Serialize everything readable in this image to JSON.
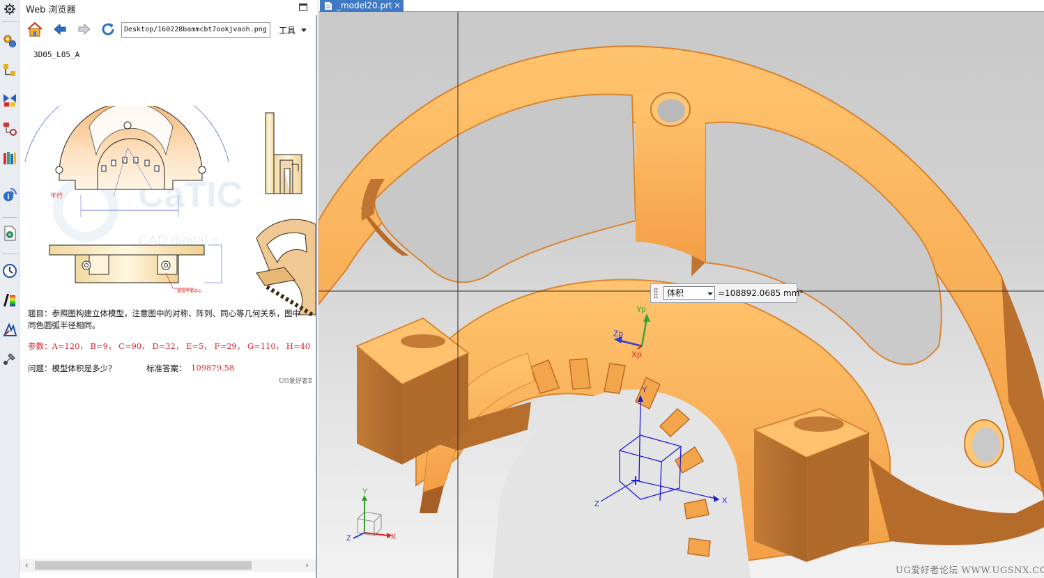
{
  "browser": {
    "title": "Web 浏览器",
    "address": "Desktop/160228bammcbt7ookjvaoh.png",
    "tools_menu": "工具",
    "icons": [
      "home-icon",
      "back-arrow-icon",
      "forward-arrow-icon",
      "refresh-icon"
    ]
  },
  "document": {
    "code": "3D05_L05_A",
    "question_text": "题目：参照图构建立体模型，注意图中的对称、阵列、同心等几何关系，图中同色圆弧半径相同。",
    "params": "参数：A=120， B=9， C=90， D=32， E=5， F=29， G=110， H=40",
    "question": "问题：模型体积是多少？",
    "answer_label": "标准答案：",
    "answer_value": "109879.58",
    "signature": "UG爱好者Ⅱ",
    "drawing_labels": {
      "parallel": "平行",
      "hole_center": "基准平面中心",
      "watermark_big": "CaTIC",
      "watermark_small": "CAD digital c"
    }
  },
  "resource_bar": {
    "icons": [
      "settings-gear-icon",
      "assembly-navigator-icon",
      "constraint-navigator-icon",
      "part-navigator-icon",
      "reuse-library-icon",
      "hd3d-tools-icon",
      "web-browser-icon",
      "history-icon",
      "visualization-icon",
      "process-studio-icon",
      "manufacturing-wizard-icon"
    ]
  },
  "graphics": {
    "tab_label": "_model20.prt",
    "measure": {
      "type_selected": "体积",
      "value": "=108892.0685 mm³"
    },
    "triad_labels": {
      "yp": "Yp",
      "zp": "Zp",
      "xp": "Xp"
    },
    "wcs_labels": {
      "x": "X",
      "y": "Y",
      "z": "Z"
    },
    "view_triad_labels": {
      "x": "X",
      "y": "Y",
      "z": "Z"
    },
    "watermark": "UG爱好者论坛 WWW.UGSNX.COM",
    "colors": {
      "part": "#f0a24a",
      "part_shadow": "#bf7734",
      "part_light": "#ffc872",
      "background_top": "#c9c9c9",
      "wcs": "#1c1cd0",
      "tab": "#3d79c4"
    }
  }
}
